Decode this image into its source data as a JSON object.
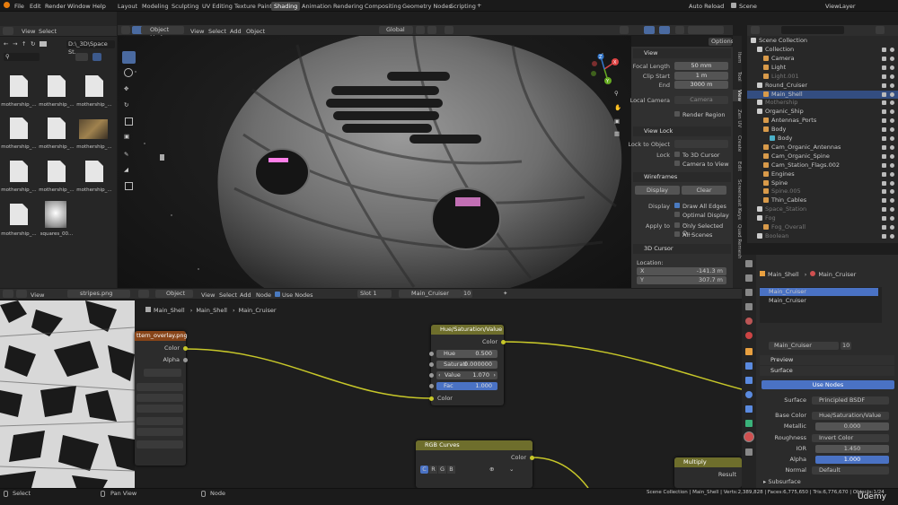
{
  "menu": {
    "file": "File",
    "edit": "Edit",
    "render": "Render",
    "window": "Window",
    "help": "Help"
  },
  "workspaces": [
    "Layout",
    "Modeling",
    "Sculpting",
    "UV Editing",
    "Texture Paint",
    "Shading",
    "Animation",
    "Rendering",
    "Compositing",
    "Geometry Nodes",
    "Scripting"
  ],
  "active_workspace": "Shading",
  "topright": {
    "auto_reload": "Auto Reload",
    "scene": "Scene",
    "view_layer": "ViewLayer"
  },
  "browser": {
    "menu_view": "View",
    "menu_select": "Select",
    "path": "D:\\_3D\\Space St...",
    "files": [
      "mothership_...",
      "mothership_...",
      "mothership_...",
      "mothership_...",
      "mothership_...",
      "mothership_...",
      "mothership_...",
      "mothership_...",
      "mothership_...",
      "mothership_...",
      "squares_00..."
    ]
  },
  "viewport": {
    "mode": "Object Mode",
    "menu_view": "View",
    "menu_select": "Select",
    "menu_add": "Add",
    "menu_object": "Object",
    "orientation": "Global",
    "options": "Options",
    "gizmo": {
      "x": "X",
      "y": "Y",
      "z": "Z"
    }
  },
  "side_tabs": [
    "Item",
    "Tool",
    "View",
    "Zen UV",
    "Create",
    "Edit",
    "Screencast Keys",
    "Quad Remesh"
  ],
  "view_panel": {
    "view_title": "View",
    "focal_label": "Focal Length",
    "focal_value": "50 mm",
    "clip_start_label": "Clip Start",
    "clip_start_value": "1 m",
    "end_label": "End",
    "end_value": "3000 m",
    "local_camera_label": "Local Camera",
    "local_camera_value": "Camera",
    "render_region": "Render Region",
    "view_lock_title": "View Lock",
    "lock_to_object": "Lock to Object",
    "lock_label": "Lock",
    "to_3d_cursor": "To 3D Cursor",
    "camera_to_view": "Camera to View",
    "wireframes_title": "Wireframes",
    "display_btn": "Display",
    "clear_btn": "Clear",
    "display_label": "Display",
    "draw_all_edges": "Draw All Edges",
    "optimal_display": "Optimal Display ...",
    "apply_to_label": "Apply to",
    "only_selected": "Only Selected O...",
    "all_scenes": "All Scenes",
    "cursor_title": "3D Cursor",
    "location_label": "Location:",
    "x_label": "X",
    "x_value": "-141.3 m",
    "y_label": "Y",
    "y_value": "307.7 m"
  },
  "outliner": {
    "scene_collection": "Scene Collection",
    "items": [
      {
        "name": "Collection",
        "depth": 1,
        "color": "#cccccc"
      },
      {
        "name": "Camera",
        "depth": 2,
        "color": "#d89a4a"
      },
      {
        "name": "Light",
        "depth": 2,
        "color": "#d89a4a"
      },
      {
        "name": "Light.001",
        "depth": 2,
        "color": "#d89a4a",
        "dim": true
      },
      {
        "name": "Round_Cruiser",
        "depth": 1,
        "color": "#cccccc"
      },
      {
        "name": "Main_Shell",
        "depth": 2,
        "color": "#d89a4a",
        "selected": true
      },
      {
        "name": "Mothership",
        "depth": 1,
        "color": "#cccccc",
        "dim": true
      },
      {
        "name": "Organic_Ship",
        "depth": 1,
        "color": "#cccccc"
      },
      {
        "name": "Antennas_Ports",
        "depth": 2,
        "color": "#d89a4a"
      },
      {
        "name": "Body",
        "depth": 2,
        "color": "#d89a4a"
      },
      {
        "name": "Body",
        "depth": 3,
        "color": "#4ab0c8"
      },
      {
        "name": "Cam_Organic_Antennas",
        "depth": 2,
        "color": "#d89a4a"
      },
      {
        "name": "Cam_Organic_Spine",
        "depth": 2,
        "color": "#d89a4a"
      },
      {
        "name": "Cam_Station_Flags.002",
        "depth": 2,
        "color": "#d89a4a"
      },
      {
        "name": "Engines",
        "depth": 2,
        "color": "#d89a4a"
      },
      {
        "name": "Spine",
        "depth": 2,
        "color": "#d89a4a"
      },
      {
        "name": "Spine.005",
        "depth": 2,
        "color": "#d89a4a",
        "dim": true
      },
      {
        "name": "Thin_Cables",
        "depth": 2,
        "color": "#d89a4a"
      },
      {
        "name": "Space_Station",
        "depth": 1,
        "color": "#cccccc",
        "dim": true
      },
      {
        "name": "Fog",
        "depth": 1,
        "color": "#cccccc",
        "dim": true
      },
      {
        "name": "Fog_Overall",
        "depth": 2,
        "color": "#d89a4a",
        "dim": true
      },
      {
        "name": "Boolean",
        "depth": 1,
        "color": "#cccccc",
        "dim": true
      }
    ]
  },
  "image_editor": {
    "menu_view": "View",
    "image_name": "stripes.png"
  },
  "node_editor": {
    "object_label": "Object",
    "menu_view": "View",
    "menu_select": "Select",
    "menu_add": "Add",
    "menu_node": "Node",
    "use_nodes": "Use Nodes",
    "slot": "Slot 1",
    "material": "Main_Cruiser",
    "users": "10",
    "breadcrumb": [
      "Main_Shell",
      "Main_Shell",
      "Main_Cruiser"
    ]
  },
  "nodes": {
    "image_node": {
      "title": "ttern_overlay.png",
      "out_color": "Color",
      "out_alpha": "Alpha"
    },
    "hsv": {
      "title": "Hue/Saturation/Value",
      "out_color": "Color",
      "hue_label": "Hue",
      "hue_value": "0.500",
      "sat_label": "Saturati",
      "sat_value": "0.000000",
      "val_label": "Value",
      "val_value": "1.070",
      "fac_label": "Fac",
      "fac_value": "1.000",
      "in_color": "Color"
    },
    "rgb_curves": {
      "title": "RGB Curves",
      "out_color": "Color",
      "c": "C",
      "r": "R",
      "g": "G",
      "b": "B"
    },
    "multiply": {
      "title": "Multiply",
      "out_result": "Result"
    }
  },
  "material_panel": {
    "breadcrumb_obj": "Main_Shell",
    "breadcrumb_mat": "Main_Cruiser",
    "slots": [
      "Main_Cruiser",
      "Main_Cruiser"
    ],
    "material": "Main_Cruiser",
    "users": "10",
    "preview": "Preview",
    "surface": "Surface",
    "use_nodes": "Use Nodes",
    "surface_label": "Surface",
    "surface_value": "Principled BSDF",
    "base_color_label": "Base Color",
    "base_color_value": "Hue/Saturation/Value",
    "metallic_label": "Metallic",
    "metallic_value": "0.000",
    "roughness_label": "Roughness",
    "roughness_value": "Invert Color",
    "ior_label": "IOR",
    "ior_value": "1.450",
    "alpha_label": "Alpha",
    "alpha_value": "1.000",
    "normal_label": "Normal",
    "normal_value": "Default",
    "subsurface": "Subsurface"
  },
  "status": {
    "select": "Select",
    "pan_view": "Pan View",
    "node": "Node",
    "stats": "Scene Collection | Main_Shell | Verts:2,389,828 | Faces:6,775,650 | Tris:6,776,670 | Objects:1/24",
    "watermark": "Ûdemy"
  }
}
